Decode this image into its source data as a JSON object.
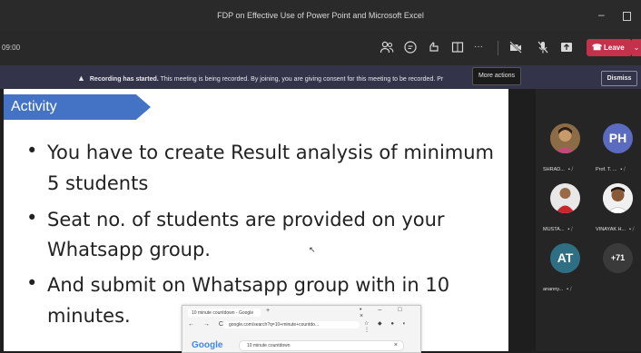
{
  "window": {
    "title": "FDP on Effective Use of Power Point and Microsoft Excel",
    "minimize_glyph": "–"
  },
  "toolbar": {
    "timer": "09:00",
    "icons": [
      "people-icon",
      "chat-icon",
      "reactions-icon",
      "rooms-icon",
      "more-actions-icon",
      "camera-off-icon",
      "mic-off-icon",
      "share-icon"
    ],
    "more_glyph": "···",
    "leave_label": "Leave",
    "leave_color": "#c4314b"
  },
  "banner": {
    "bold": "Recording has started.",
    "message": "This meeting is being recorded. By joining, you are giving consent for this meeting to be recorded.",
    "trailing": "Pr",
    "tooltip": "More actions",
    "dismiss_label": "Dismiss"
  },
  "slide": {
    "tag": "Activity",
    "tag_color": "#4472c4",
    "lines": [
      "You have to create Result analysis of minimum",
      "5 students",
      "Seat no. of students are provided on your",
      "Whatsapp group.",
      "And submit on Whatsapp group with in 10",
      "minutes."
    ],
    "browser": {
      "tab_title": "10 minute countdown - Google",
      "url": "google.com/search?q=10+minute+countdo...",
      "logo": "Google",
      "search": "10 minute countdown"
    }
  },
  "participants": [
    {
      "name": "SHRAD...",
      "kind": "photo"
    },
    {
      "name": "Prof. T. ...",
      "initials": "PH",
      "color": "#5b6bbf"
    },
    {
      "name": "MUSTA...",
      "kind": "photo"
    },
    {
      "name": "VINAYAK H...",
      "kind": "photo"
    },
    {
      "name": "ananny...",
      "initials": "AT",
      "color": "#2e6f83"
    },
    {
      "name": "",
      "initials": "+71",
      "color": "#3a3a3a"
    }
  ]
}
